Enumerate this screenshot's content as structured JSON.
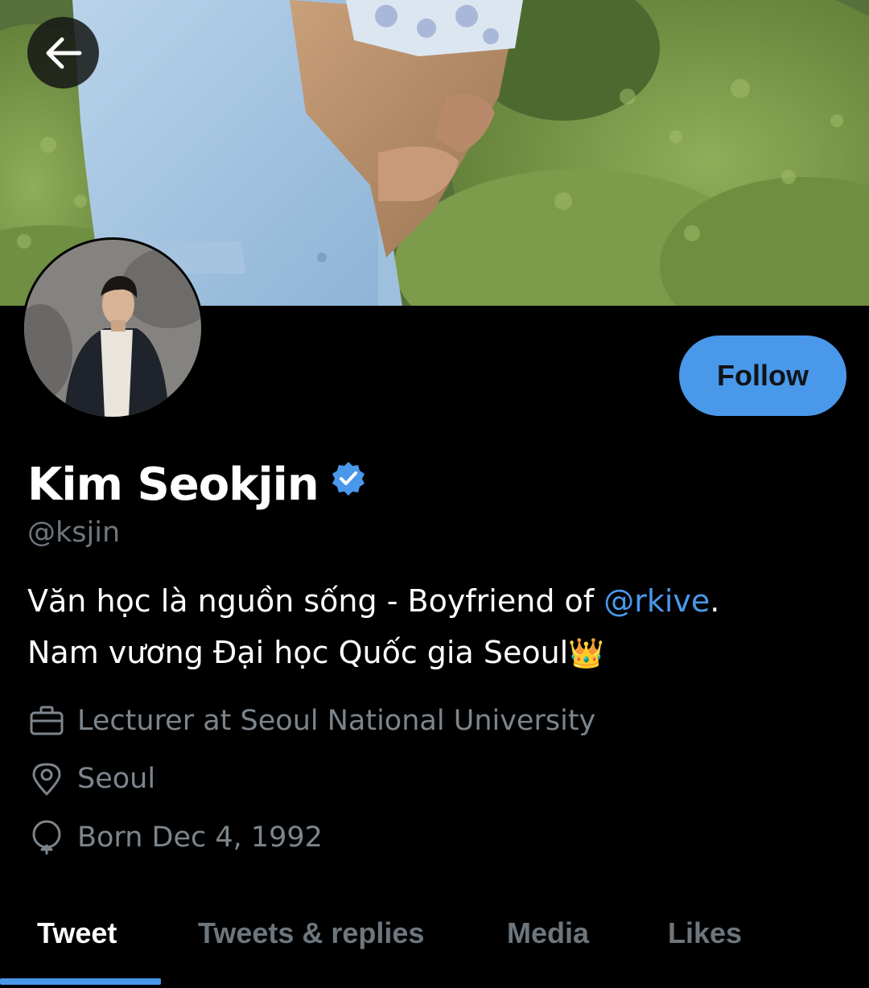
{
  "header": {
    "back_icon": "arrow-left-icon",
    "banner_image": "cover photo: person in light blue suit holding flower bouquet, green shrubs",
    "avatar_image": "profile photo: man in dark coat and cream sweater"
  },
  "profile": {
    "display_name": "Kim Seokjin",
    "verified_icon": "verified-badge-icon",
    "handle": "@ksjin",
    "follow_label": "Follow",
    "bio": {
      "line1_prefix": "Văn học là nguồn sống - Boyfriend of ",
      "mention": "@rkive",
      "line1_suffix": ".",
      "line2_text": "Nam vương Đại học Quốc gia Seoul",
      "line2_emoji": "👑"
    },
    "meta": {
      "work": "Lecturer at Seoul National University",
      "work_icon": "briefcase-icon",
      "location": "Seoul",
      "location_icon": "location-pin-icon",
      "birthday": "Born Dec 4, 1992",
      "birthday_icon": "balloon-icon"
    }
  },
  "tabs": [
    {
      "label": "Tweet",
      "active": true
    },
    {
      "label": "Tweets & replies",
      "active": false
    },
    {
      "label": "Media",
      "active": false
    },
    {
      "label": "Likes",
      "active": false
    }
  ],
  "colors": {
    "accent": "#4a98ea",
    "background": "#000000",
    "secondary_text": "#6e767d"
  }
}
